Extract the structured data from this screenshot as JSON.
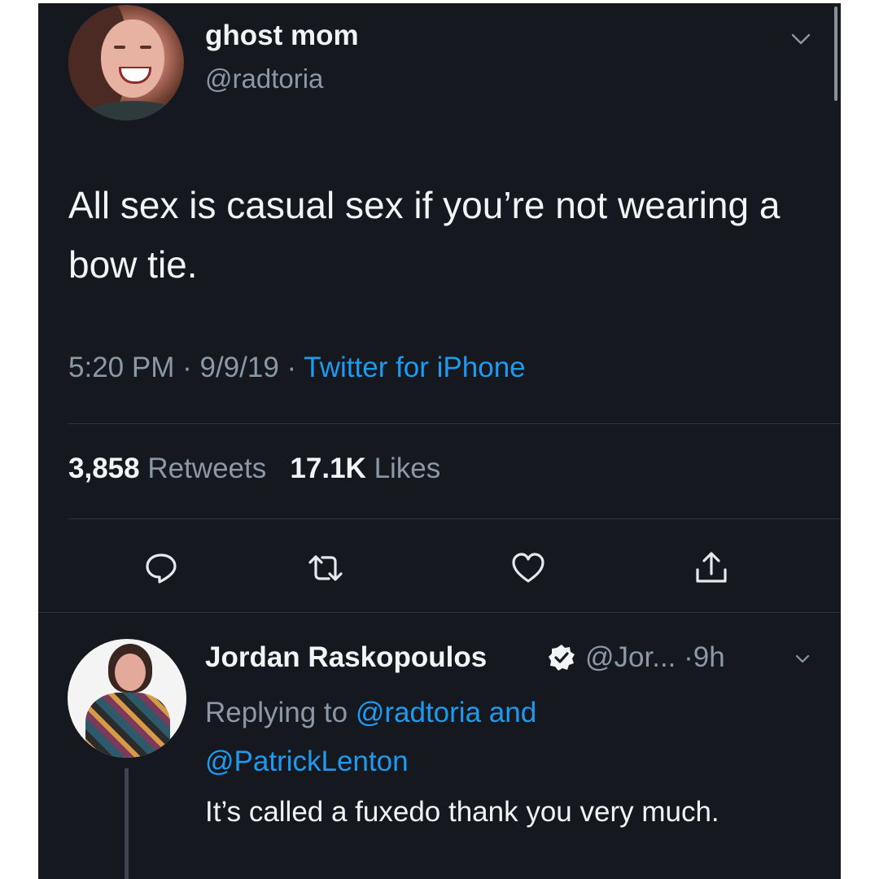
{
  "tweet": {
    "display_name": "ghost mom",
    "handle": "@radtoria",
    "text": "All sex is casual sex if you’re not wearing a bow tie.",
    "time": "5:20 PM",
    "date": "9/9/19",
    "source": "Twitter for iPhone",
    "retweets_count": "3,858",
    "retweets_label": "Retweets",
    "likes_count": "17.1K",
    "likes_label": "Likes",
    "icons": [
      "reply-icon",
      "retweet-icon",
      "like-icon",
      "share-icon",
      "chevron-down-icon"
    ]
  },
  "reply": {
    "display_name": "Jordan Raskopoulos",
    "handle": "@Jor...",
    "age": "9h",
    "replying_prefix": "Replying to",
    "mention_1": "@radtoria",
    "and_word": "and",
    "mention_2": "@PatrickLenton",
    "text": "It’s called a fuxedo thank you very much."
  },
  "colors": {
    "background": "#15181f",
    "link": "#1d9bf0",
    "secondary_text": "#8b98a5",
    "primary_text": "#f2f4f6"
  }
}
